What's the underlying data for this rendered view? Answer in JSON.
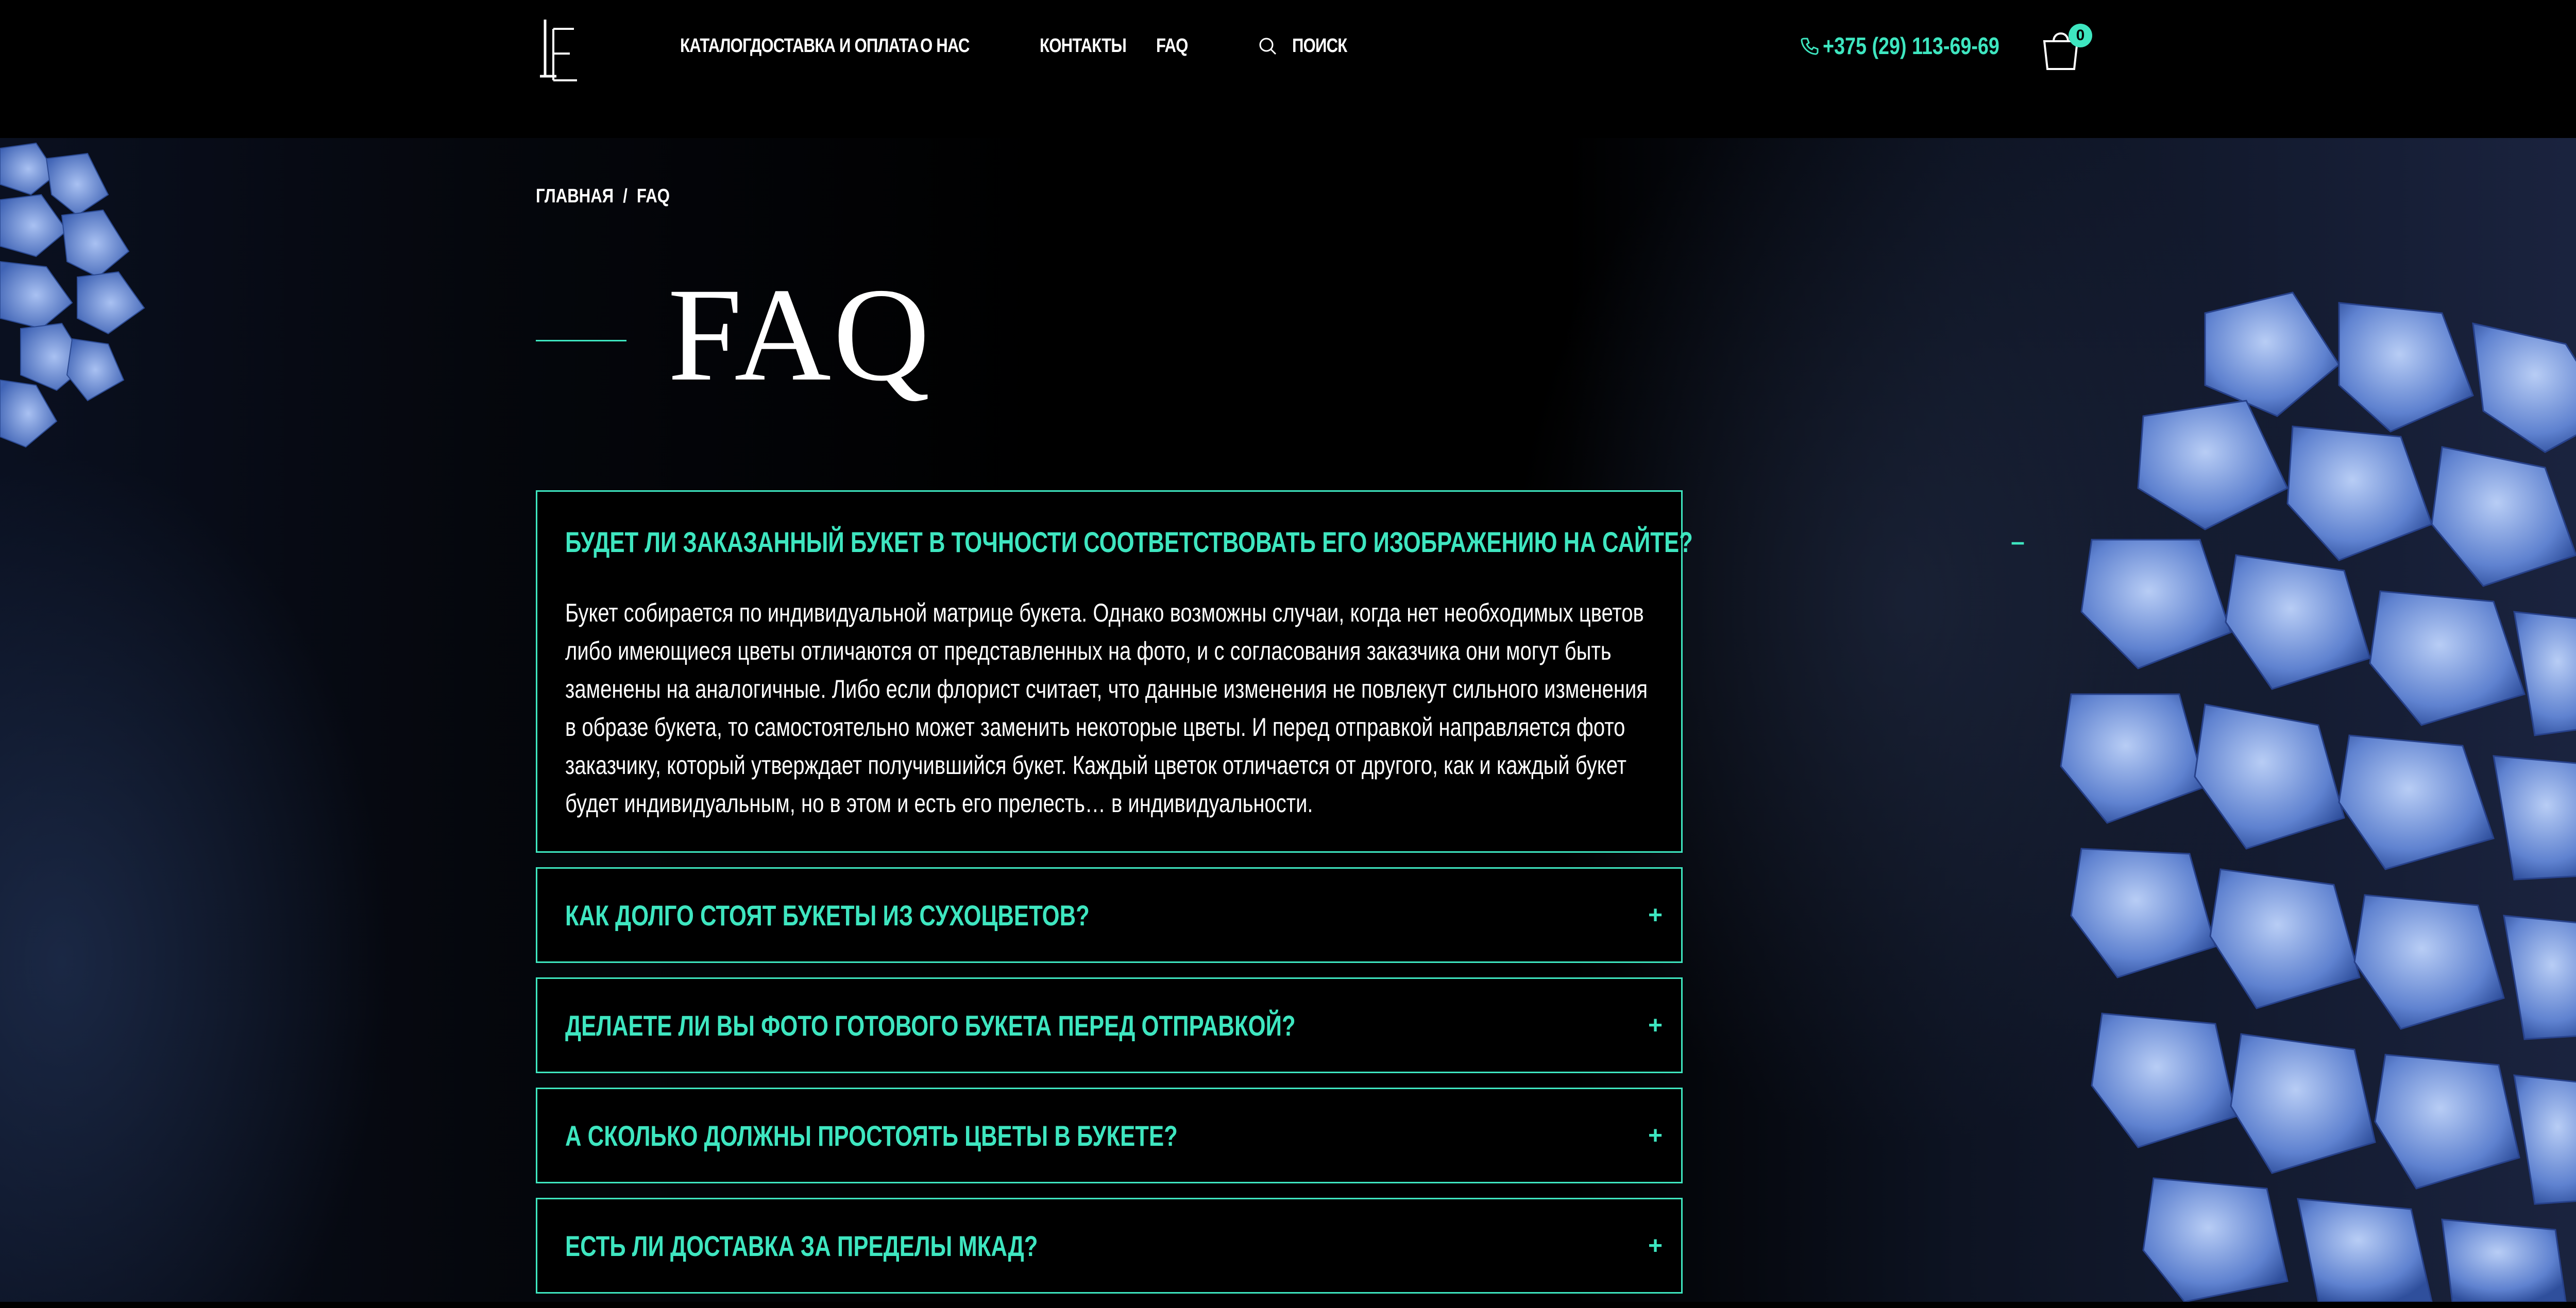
{
  "header": {
    "nav": [
      {
        "label": "КАТАЛОГ"
      },
      {
        "label": "ДОСТАВКА И ОПЛАТА"
      },
      {
        "label": "О НАС"
      },
      {
        "label": "КОНТАКТЫ"
      },
      {
        "label": "FAQ"
      }
    ],
    "search_label": "ПОИСК",
    "phone": "+375 (29) 113-69-69",
    "cart_count": "0"
  },
  "breadcrumb": {
    "home": "ГЛАВНАЯ",
    "separator": "/",
    "current": "FAQ"
  },
  "page_title": "FAQ",
  "faq": [
    {
      "question": "БУДЕТ ЛИ ЗАКАЗАННЫЙ БУКЕТ В ТОЧНОСТИ СООТВЕТСТВОВАТЬ ЕГО ИЗОБРАЖЕНИЮ НА САЙТЕ?",
      "toggle": "–",
      "answer": "Букет собирается по индивидуальной матрице букета. Однако возможны случаи, когда нет необходимых цветов либо имеющиеся цветы отличаются от представленных на фото, и с согласования заказчика они могут быть заменены на аналогичные. Либо если флорист считает, что данные изменения не повлекут сильного изменения в образе букета, то самостоятельно может заменить некоторые цветы. И перед отправкой направляется фото заказчику, который утверждает получившийся букет. Каждый цветок отличается от другого, как и каждый букет будет индивидуальным, но в этом и есть его прелесть… в индивидуальности."
    },
    {
      "question": "КАК ДОЛГО СТОЯТ БУКЕТЫ ИЗ СУХОЦВЕТОВ?",
      "toggle": "+"
    },
    {
      "question": "ДЕЛАЕТЕ ЛИ ВЫ ФОТО ГОТОВОГО БУКЕТА ПЕРЕД ОТПРАВКОЙ?",
      "toggle": "+"
    },
    {
      "question": "А СКОЛЬКО ДОЛЖНЫ ПРОСТОЯТЬ ЦВЕТЫ В БУКЕТЕ?",
      "toggle": "+"
    },
    {
      "question": "ЕСТЬ ЛИ ДОСТАВКА ЗА ПРЕДЕЛЫ МКАД?",
      "toggle": "+"
    }
  ],
  "colors": {
    "accent": "#3ee6c0",
    "background": "#000000",
    "hydrangea": "#5f82d0"
  }
}
